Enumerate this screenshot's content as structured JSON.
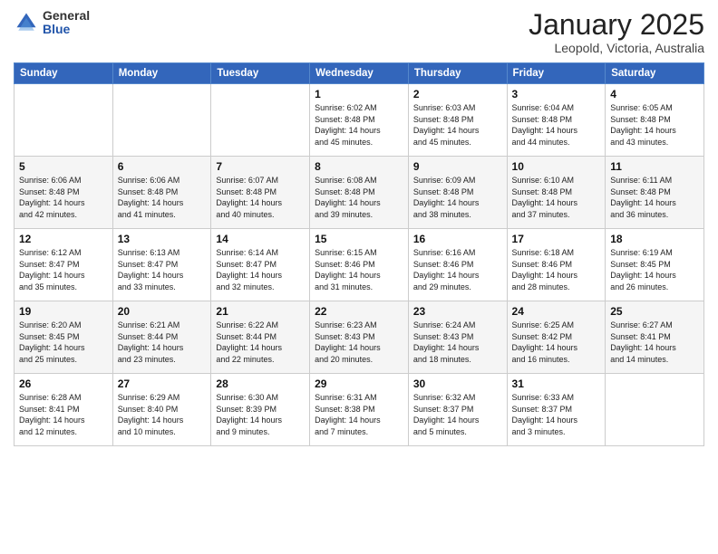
{
  "logo": {
    "general": "General",
    "blue": "Blue"
  },
  "header": {
    "month_title": "January 2025",
    "location": "Leopold, Victoria, Australia"
  },
  "days_of_week": [
    "Sunday",
    "Monday",
    "Tuesday",
    "Wednesday",
    "Thursday",
    "Friday",
    "Saturday"
  ],
  "weeks": [
    [
      {
        "day": "",
        "info": ""
      },
      {
        "day": "",
        "info": ""
      },
      {
        "day": "",
        "info": ""
      },
      {
        "day": "1",
        "info": "Sunrise: 6:02 AM\nSunset: 8:48 PM\nDaylight: 14 hours\nand 45 minutes."
      },
      {
        "day": "2",
        "info": "Sunrise: 6:03 AM\nSunset: 8:48 PM\nDaylight: 14 hours\nand 45 minutes."
      },
      {
        "day": "3",
        "info": "Sunrise: 6:04 AM\nSunset: 8:48 PM\nDaylight: 14 hours\nand 44 minutes."
      },
      {
        "day": "4",
        "info": "Sunrise: 6:05 AM\nSunset: 8:48 PM\nDaylight: 14 hours\nand 43 minutes."
      }
    ],
    [
      {
        "day": "5",
        "info": "Sunrise: 6:06 AM\nSunset: 8:48 PM\nDaylight: 14 hours\nand 42 minutes."
      },
      {
        "day": "6",
        "info": "Sunrise: 6:06 AM\nSunset: 8:48 PM\nDaylight: 14 hours\nand 41 minutes."
      },
      {
        "day": "7",
        "info": "Sunrise: 6:07 AM\nSunset: 8:48 PM\nDaylight: 14 hours\nand 40 minutes."
      },
      {
        "day": "8",
        "info": "Sunrise: 6:08 AM\nSunset: 8:48 PM\nDaylight: 14 hours\nand 39 minutes."
      },
      {
        "day": "9",
        "info": "Sunrise: 6:09 AM\nSunset: 8:48 PM\nDaylight: 14 hours\nand 38 minutes."
      },
      {
        "day": "10",
        "info": "Sunrise: 6:10 AM\nSunset: 8:48 PM\nDaylight: 14 hours\nand 37 minutes."
      },
      {
        "day": "11",
        "info": "Sunrise: 6:11 AM\nSunset: 8:48 PM\nDaylight: 14 hours\nand 36 minutes."
      }
    ],
    [
      {
        "day": "12",
        "info": "Sunrise: 6:12 AM\nSunset: 8:47 PM\nDaylight: 14 hours\nand 35 minutes."
      },
      {
        "day": "13",
        "info": "Sunrise: 6:13 AM\nSunset: 8:47 PM\nDaylight: 14 hours\nand 33 minutes."
      },
      {
        "day": "14",
        "info": "Sunrise: 6:14 AM\nSunset: 8:47 PM\nDaylight: 14 hours\nand 32 minutes."
      },
      {
        "day": "15",
        "info": "Sunrise: 6:15 AM\nSunset: 8:46 PM\nDaylight: 14 hours\nand 31 minutes."
      },
      {
        "day": "16",
        "info": "Sunrise: 6:16 AM\nSunset: 8:46 PM\nDaylight: 14 hours\nand 29 minutes."
      },
      {
        "day": "17",
        "info": "Sunrise: 6:18 AM\nSunset: 8:46 PM\nDaylight: 14 hours\nand 28 minutes."
      },
      {
        "day": "18",
        "info": "Sunrise: 6:19 AM\nSunset: 8:45 PM\nDaylight: 14 hours\nand 26 minutes."
      }
    ],
    [
      {
        "day": "19",
        "info": "Sunrise: 6:20 AM\nSunset: 8:45 PM\nDaylight: 14 hours\nand 25 minutes."
      },
      {
        "day": "20",
        "info": "Sunrise: 6:21 AM\nSunset: 8:44 PM\nDaylight: 14 hours\nand 23 minutes."
      },
      {
        "day": "21",
        "info": "Sunrise: 6:22 AM\nSunset: 8:44 PM\nDaylight: 14 hours\nand 22 minutes."
      },
      {
        "day": "22",
        "info": "Sunrise: 6:23 AM\nSunset: 8:43 PM\nDaylight: 14 hours\nand 20 minutes."
      },
      {
        "day": "23",
        "info": "Sunrise: 6:24 AM\nSunset: 8:43 PM\nDaylight: 14 hours\nand 18 minutes."
      },
      {
        "day": "24",
        "info": "Sunrise: 6:25 AM\nSunset: 8:42 PM\nDaylight: 14 hours\nand 16 minutes."
      },
      {
        "day": "25",
        "info": "Sunrise: 6:27 AM\nSunset: 8:41 PM\nDaylight: 14 hours\nand 14 minutes."
      }
    ],
    [
      {
        "day": "26",
        "info": "Sunrise: 6:28 AM\nSunset: 8:41 PM\nDaylight: 14 hours\nand 12 minutes."
      },
      {
        "day": "27",
        "info": "Sunrise: 6:29 AM\nSunset: 8:40 PM\nDaylight: 14 hours\nand 10 minutes."
      },
      {
        "day": "28",
        "info": "Sunrise: 6:30 AM\nSunset: 8:39 PM\nDaylight: 14 hours\nand 9 minutes."
      },
      {
        "day": "29",
        "info": "Sunrise: 6:31 AM\nSunset: 8:38 PM\nDaylight: 14 hours\nand 7 minutes."
      },
      {
        "day": "30",
        "info": "Sunrise: 6:32 AM\nSunset: 8:37 PM\nDaylight: 14 hours\nand 5 minutes."
      },
      {
        "day": "31",
        "info": "Sunrise: 6:33 AM\nSunset: 8:37 PM\nDaylight: 14 hours\nand 3 minutes."
      },
      {
        "day": "",
        "info": ""
      }
    ]
  ]
}
